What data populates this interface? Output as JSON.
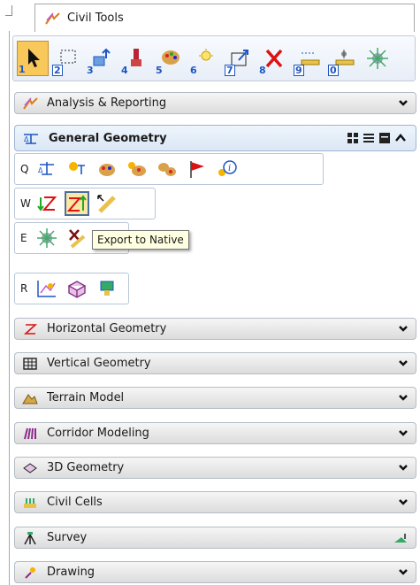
{
  "panel": {
    "title": "Civil Tools"
  },
  "toolbar": {
    "tools": [
      {
        "num": "1",
        "icon": "select-arrow-icon"
      },
      {
        "num": "2",
        "icon": "selection-box-icon"
      },
      {
        "num": "3",
        "icon": "manipulate-icon"
      },
      {
        "num": "4",
        "icon": "paint-icon"
      },
      {
        "num": "5",
        "icon": "palette-icon"
      },
      {
        "num": "6",
        "icon": "light-icon"
      },
      {
        "num": "7",
        "icon": "scale-icon"
      },
      {
        "num": "8",
        "icon": "delete-x-icon"
      },
      {
        "num": "9",
        "icon": "measure-icon"
      },
      {
        "num": "0",
        "icon": "tool-icon"
      },
      {
        "num": "",
        "icon": "sparkle-icon"
      }
    ]
  },
  "sections": {
    "analysis": "Analysis & Reporting",
    "general": "General Geometry",
    "horizontal": "Horizontal Geometry",
    "vertical": "Vertical Geometry",
    "terrain": "Terrain Model",
    "corridor": "Corridor Modeling",
    "geometry3d": "3D Geometry",
    "cells": "Civil Cells",
    "survey": "Survey",
    "drawing": "Drawing"
  },
  "rows": {
    "q": "Q",
    "w": "W",
    "e": "E",
    "r": "R"
  },
  "tooltip": "Export to Native",
  "colors": {
    "accent": "#1e56c2",
    "active": "#f9c85b",
    "header_open": "#dbe7f5"
  }
}
